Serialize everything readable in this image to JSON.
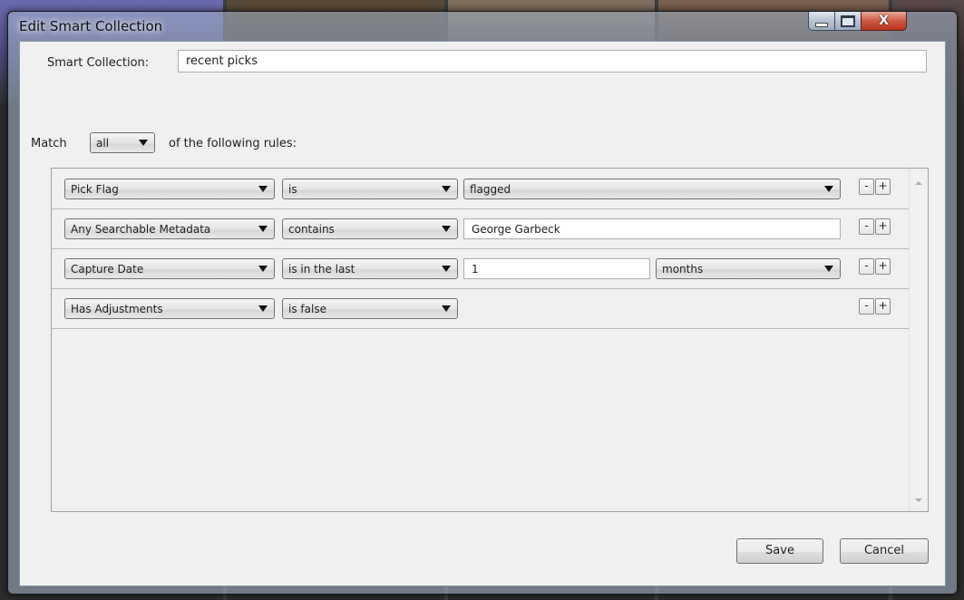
{
  "window": {
    "title": "Edit Smart Collection",
    "close_glyph": "X"
  },
  "form": {
    "name_label": "Smart Collection:",
    "name_value": "recent picks",
    "match_label": "Match",
    "match_value": "all",
    "match_suffix": "of the following rules:"
  },
  "rules": [
    {
      "field": "Pick Flag",
      "operator": "is",
      "value": "flagged",
      "value_kind": "select"
    },
    {
      "field": "Any Searchable Metadata",
      "operator": "contains",
      "value": "George Garbeck",
      "value_kind": "text"
    },
    {
      "field": "Capture Date",
      "operator": "is in the last",
      "value": "1",
      "unit": "months",
      "value_kind": "number-unit"
    },
    {
      "field": "Has Adjustments",
      "operator": "is false",
      "value_kind": "none"
    }
  ],
  "rule_controls": {
    "remove": "-",
    "add": "+"
  },
  "buttons": {
    "save": "Save",
    "cancel": "Cancel"
  },
  "icons": {
    "minimize": "minimize-icon",
    "maximize": "maximize-icon",
    "close": "close-icon",
    "dropdown": "chevron-down-icon"
  }
}
